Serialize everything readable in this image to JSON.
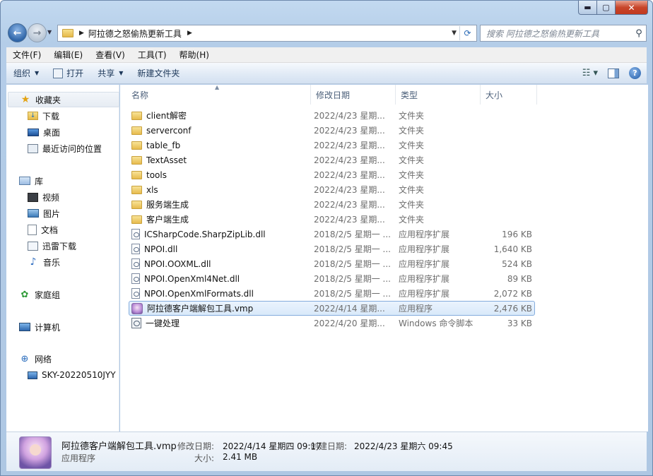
{
  "window": {
    "controls": {
      "minimize": "▬",
      "maximize": "▢",
      "close": "✕"
    }
  },
  "address": {
    "path": "阿拉德之怒偷热更新工具",
    "search_placeholder": "搜索 阿拉德之怒偷热更新工具"
  },
  "menu": [
    "文件(F)",
    "编辑(E)",
    "查看(V)",
    "工具(T)",
    "帮助(H)"
  ],
  "toolbar": {
    "organize": "组织",
    "open": "打开",
    "share": "共享",
    "new_folder": "新建文件夹"
  },
  "sidebar": {
    "favorites": {
      "label": "收藏夹",
      "items": [
        "下载",
        "桌面",
        "最近访问的位置"
      ]
    },
    "libraries": {
      "label": "库",
      "items": [
        "视频",
        "图片",
        "文档",
        "迅雷下载",
        "音乐"
      ]
    },
    "homegroup": "家庭组",
    "computer": "计算机",
    "network": {
      "label": "网络",
      "items": [
        "SKY-20220510JYY"
      ]
    }
  },
  "columns": {
    "name": "名称",
    "date": "修改日期",
    "type": "类型",
    "size": "大小"
  },
  "files": [
    {
      "icon": "folder",
      "name": "client解密",
      "date": "2022/4/23 星期...",
      "type": "文件夹",
      "size": ""
    },
    {
      "icon": "folder",
      "name": "serverconf",
      "date": "2022/4/23 星期...",
      "type": "文件夹",
      "size": ""
    },
    {
      "icon": "folder",
      "name": "table_fb",
      "date": "2022/4/23 星期...",
      "type": "文件夹",
      "size": ""
    },
    {
      "icon": "folder",
      "name": "TextAsset",
      "date": "2022/4/23 星期...",
      "type": "文件夹",
      "size": ""
    },
    {
      "icon": "folder",
      "name": "tools",
      "date": "2022/4/23 星期...",
      "type": "文件夹",
      "size": ""
    },
    {
      "icon": "folder",
      "name": "xls",
      "date": "2022/4/23 星期...",
      "type": "文件夹",
      "size": ""
    },
    {
      "icon": "folder",
      "name": "服务端生成",
      "date": "2022/4/23 星期...",
      "type": "文件夹",
      "size": ""
    },
    {
      "icon": "folder",
      "name": "客户端生成",
      "date": "2022/4/23 星期...",
      "type": "文件夹",
      "size": ""
    },
    {
      "icon": "dll",
      "name": "ICSharpCode.SharpZipLib.dll",
      "date": "2018/2/5 星期一 ...",
      "type": "应用程序扩展",
      "size": "196 KB"
    },
    {
      "icon": "dll",
      "name": "NPOI.dll",
      "date": "2018/2/5 星期一 ...",
      "type": "应用程序扩展",
      "size": "1,640 KB"
    },
    {
      "icon": "dll",
      "name": "NPOI.OOXML.dll",
      "date": "2018/2/5 星期一 ...",
      "type": "应用程序扩展",
      "size": "524 KB"
    },
    {
      "icon": "dll",
      "name": "NPOI.OpenXml4Net.dll",
      "date": "2018/2/5 星期一 ...",
      "type": "应用程序扩展",
      "size": "89 KB"
    },
    {
      "icon": "dll",
      "name": "NPOI.OpenXmlFormats.dll",
      "date": "2018/2/5 星期一 ...",
      "type": "应用程序扩展",
      "size": "2,072 KB"
    },
    {
      "icon": "vmp",
      "name": "阿拉德客户端解包工具.vmp",
      "date": "2022/4/14 星期...",
      "type": "应用程序",
      "size": "2,476 KB",
      "selected": true
    },
    {
      "icon": "bat",
      "name": "一键处理",
      "date": "2022/4/20 星期...",
      "type": "Windows 命令脚本",
      "size": "33 KB"
    }
  ],
  "details": {
    "name": "阿拉德客户端解包工具.vmp",
    "type": "应用程序",
    "modified_label": "修改日期:",
    "modified_value": "2022/4/14 星期四 09:17",
    "created_label": "创建日期:",
    "created_value": "2022/4/23 星期六 09:45",
    "size_label": "大小:",
    "size_value": "2.41 MB"
  }
}
